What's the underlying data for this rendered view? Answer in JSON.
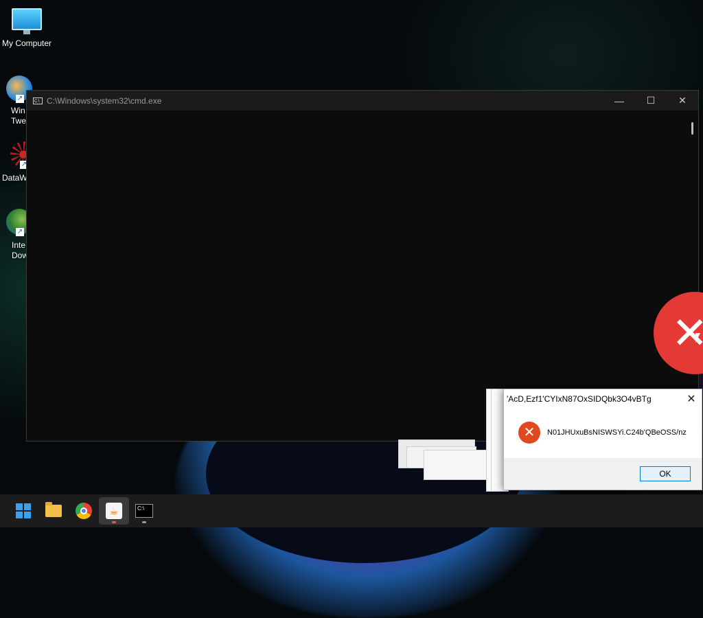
{
  "desktop": {
    "icons": [
      {
        "label": "My Computer"
      },
      {
        "label": "Win\nTwe"
      },
      {
        "label": "DataW"
      },
      {
        "label": "Inte\nDow"
      }
    ]
  },
  "cmd_window": {
    "title": "C:\\Windows\\system32\\cmd.exe",
    "icon_text": "C:\\",
    "minimize_glyph": "—",
    "maximize_glyph": "☐",
    "close_glyph": "✕"
  },
  "error_overlay": {
    "glyph": "✕"
  },
  "stacked_dialog_fragment": "p0",
  "message_box": {
    "title": "'AcD,Ezf1'CYIxN87OxSIDQbk3O4vBTg",
    "close_glyph": "✕",
    "message": "N01JHUxuBsNISWSYi.C24b'QBeOSS/nz",
    "error_glyph": "✕",
    "ok_label": "OK"
  },
  "taskbar": {
    "items": [
      {
        "name": "start",
        "icon": "windows-logo-icon"
      },
      {
        "name": "file-explorer",
        "icon": "folder-icon"
      },
      {
        "name": "chrome",
        "icon": "chrome-icon"
      },
      {
        "name": "java",
        "icon": "java-icon",
        "glyph": "☕"
      },
      {
        "name": "terminal",
        "icon": "terminal-icon",
        "glyph": "C:\\"
      }
    ]
  },
  "colors": {
    "error_red": "#e53935",
    "accent": "#0078d7"
  }
}
